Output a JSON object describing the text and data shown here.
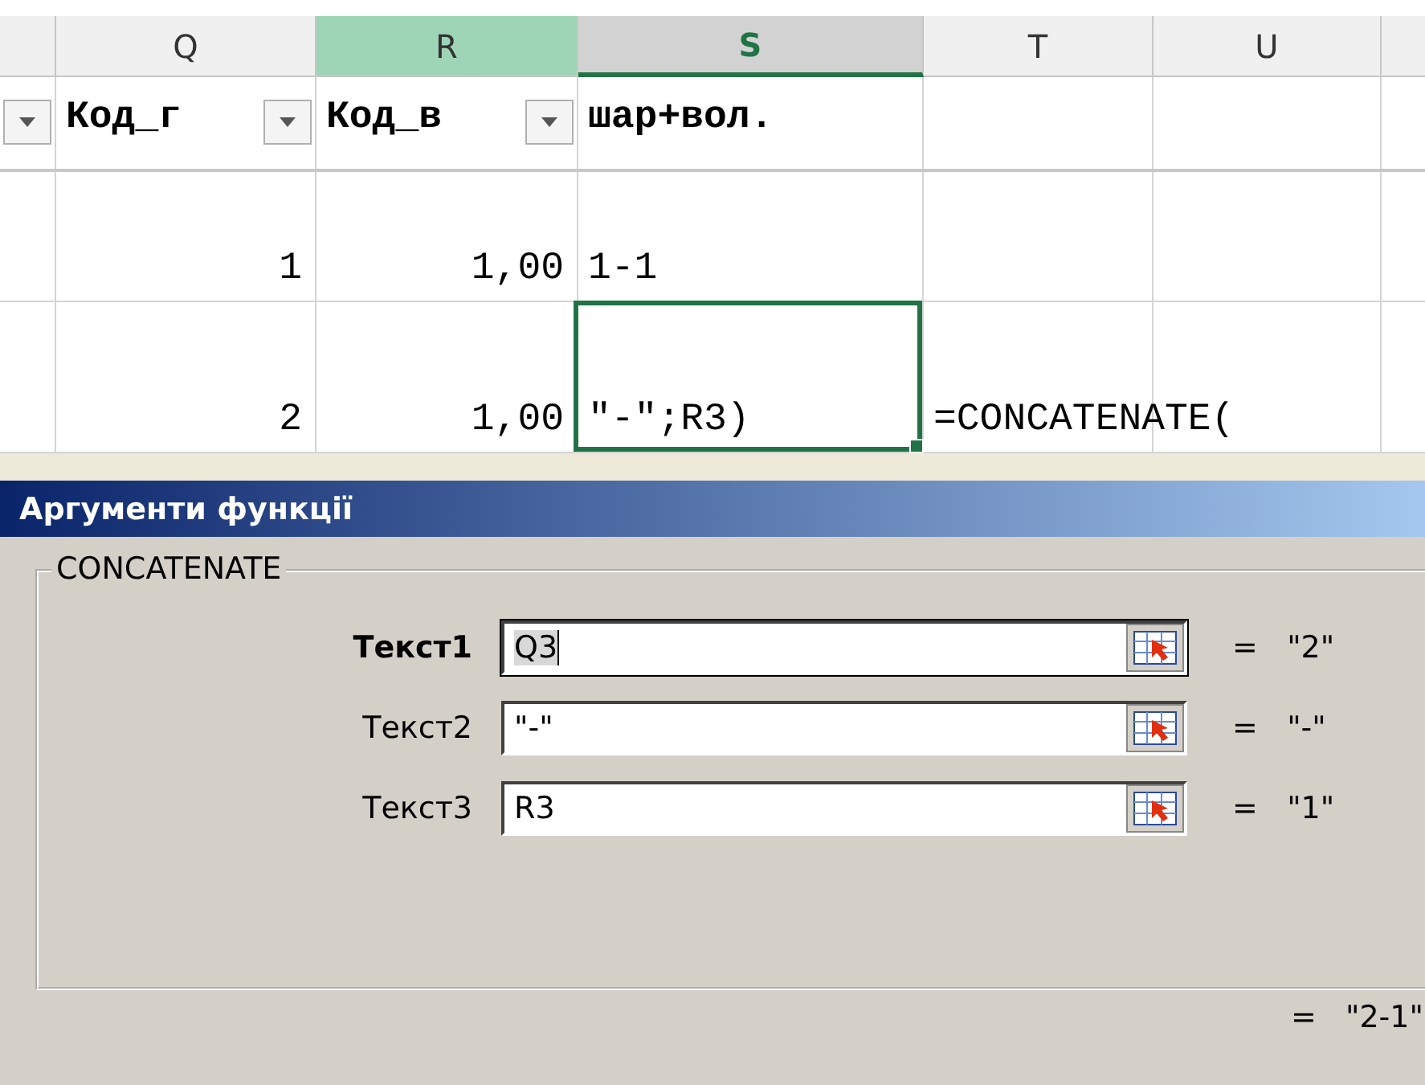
{
  "sheet": {
    "columns": [
      {
        "selected": false,
        "highlighted": false
      },
      {
        "label": "Q",
        "selected": false,
        "highlighted": false
      },
      {
        "label": "R",
        "selected": false,
        "highlighted": true
      },
      {
        "label": "S",
        "selected": true,
        "highlighted": false
      },
      {
        "label": "T",
        "selected": false,
        "highlighted": false
      },
      {
        "label": "U",
        "selected": false,
        "highlighted": false
      },
      {
        "selected": false,
        "highlighted": false
      }
    ],
    "rows": [
      {
        "kind": "header",
        "cells": [
          {
            "filter": true
          },
          {
            "text": "Код_г",
            "filter": true
          },
          {
            "text": "Код_в",
            "filter": true
          },
          {
            "text": "шар+вол."
          },
          {},
          {},
          {}
        ]
      },
      {
        "kind": "data",
        "cells": [
          {},
          {
            "text": "1",
            "numeric": true
          },
          {
            "text": "1,00",
            "numeric": true
          },
          {
            "text": "1-1"
          },
          {},
          {},
          {}
        ]
      },
      {
        "kind": "data",
        "cells": [
          {},
          {
            "text": "2",
            "numeric": true
          },
          {
            "text": "1,00",
            "numeric": true
          },
          {
            "text": "\"-\";R3)",
            "active": true
          },
          {
            "text": "=CONCATENATE("
          },
          {},
          {}
        ]
      }
    ]
  },
  "dialog": {
    "title": "Аргументи функції",
    "function": "CONCATENATE",
    "arguments": [
      {
        "label": "Текст1",
        "value": "Q3",
        "result": "= ",
        "result_value": "\"2\"",
        "focused": true
      },
      {
        "label": "Текст2",
        "value": "\"-\"",
        "result": "= ",
        "result_value": "\"-\"",
        "focused": false
      },
      {
        "label": "Текст3",
        "value": "R3",
        "result": "= ",
        "result_value": "\"1\"",
        "focused": false
      }
    ],
    "result": {
      "sign": "=",
      "value": "\"2-1\""
    }
  }
}
